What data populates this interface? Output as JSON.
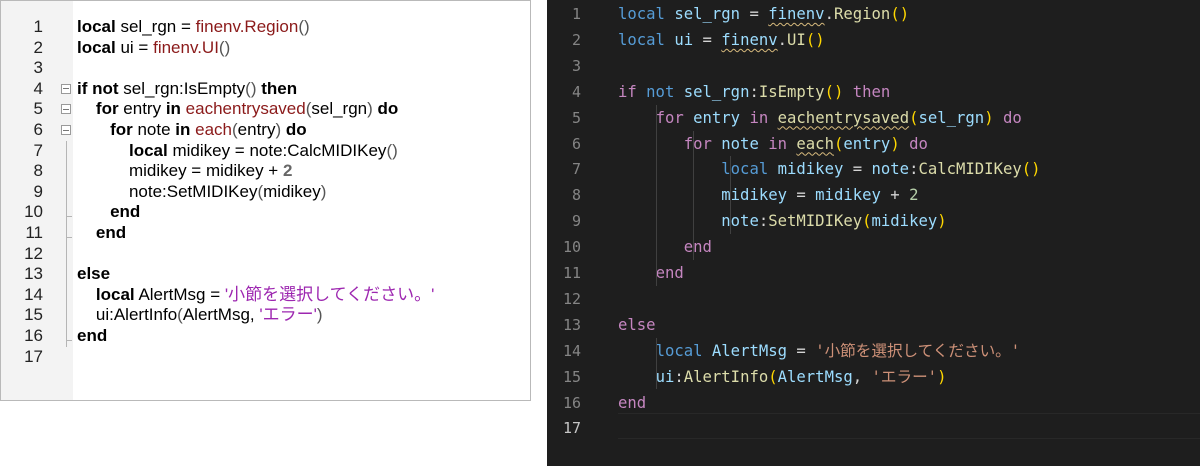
{
  "left_editor": {
    "line_numbers": [
      "1",
      "2",
      "3",
      "4",
      "5",
      "6",
      "7",
      "8",
      "9",
      "10",
      "11",
      "12",
      "13",
      "14",
      "15",
      "16",
      "17"
    ],
    "lines": [
      [
        [
          "kw",
          "local"
        ],
        [
          "t",
          " sel_rgn = "
        ],
        [
          "fn",
          "finenv.Region"
        ],
        [
          "p",
          "()"
        ]
      ],
      [
        [
          "kw",
          "local"
        ],
        [
          "t",
          " ui = "
        ],
        [
          "fn",
          "finenv.UI"
        ],
        [
          "p",
          "()"
        ]
      ],
      [],
      [
        [
          "kw",
          "if not"
        ],
        [
          "t",
          " sel_rgn:IsEmpty"
        ],
        [
          "p",
          "()"
        ],
        [
          "t",
          " "
        ],
        [
          "kw",
          "then"
        ]
      ],
      [
        [
          "t",
          "    "
        ],
        [
          "kw",
          "for"
        ],
        [
          "t",
          " entry "
        ],
        [
          "kw",
          "in"
        ],
        [
          "t",
          " "
        ],
        [
          "fn",
          "eachentrysaved"
        ],
        [
          "p",
          "("
        ],
        [
          "t",
          "sel_rgn"
        ],
        [
          "p",
          ")"
        ],
        [
          "t",
          " "
        ],
        [
          "kw",
          "do"
        ]
      ],
      [
        [
          "t",
          "       "
        ],
        [
          "kw",
          "for"
        ],
        [
          "t",
          " note "
        ],
        [
          "kw",
          "in"
        ],
        [
          "t",
          " "
        ],
        [
          "fn",
          "each"
        ],
        [
          "p",
          "("
        ],
        [
          "t",
          "entry"
        ],
        [
          "p",
          ")"
        ],
        [
          "t",
          " "
        ],
        [
          "kw",
          "do"
        ]
      ],
      [
        [
          "t",
          "           "
        ],
        [
          "kw",
          "local"
        ],
        [
          "t",
          " midikey = note:CalcMIDIKey"
        ],
        [
          "p",
          "()"
        ]
      ],
      [
        [
          "t",
          "           midikey = midikey + "
        ],
        [
          "n",
          "2"
        ]
      ],
      [
        [
          "t",
          "           note:SetMIDIKey"
        ],
        [
          "p",
          "("
        ],
        [
          "t",
          "midikey"
        ],
        [
          "p",
          ")"
        ]
      ],
      [
        [
          "t",
          "       "
        ],
        [
          "kw",
          "end"
        ]
      ],
      [
        [
          "t",
          "    "
        ],
        [
          "kw",
          "end"
        ]
      ],
      [],
      [
        [
          "kw",
          "else"
        ]
      ],
      [
        [
          "t",
          "    "
        ],
        [
          "kw",
          "local"
        ],
        [
          "t",
          " AlertMsg = "
        ],
        [
          "s",
          "'小節を選択してください。'"
        ]
      ],
      [
        [
          "t",
          "    ui:AlertInfo"
        ],
        [
          "p",
          "("
        ],
        [
          "t",
          "AlertMsg, "
        ],
        [
          "s",
          "'エラー'"
        ],
        [
          "p",
          ")"
        ]
      ],
      [
        [
          "kw",
          "end"
        ]
      ],
      []
    ]
  },
  "right_editor": {
    "line_numbers": [
      "1",
      "2",
      "3",
      "4",
      "5",
      "6",
      "7",
      "8",
      "9",
      "10",
      "11",
      "12",
      "13",
      "14",
      "15",
      "16",
      "17"
    ],
    "active_line": "17",
    "lines": [
      [
        [
          "kw",
          "local"
        ],
        [
          "t",
          " "
        ],
        [
          "v",
          "sel_rgn"
        ],
        [
          "t",
          " = "
        ],
        [
          "vw",
          "finenv"
        ],
        [
          "t",
          "."
        ],
        [
          "f",
          "Region"
        ],
        [
          "p1",
          "()"
        ]
      ],
      [
        [
          "kw",
          "local"
        ],
        [
          "t",
          " "
        ],
        [
          "v",
          "ui"
        ],
        [
          "t",
          " = "
        ],
        [
          "vw",
          "finenv"
        ],
        [
          "t",
          "."
        ],
        [
          "f",
          "UI"
        ],
        [
          "p1",
          "()"
        ]
      ],
      [],
      [
        [
          "c",
          "if"
        ],
        [
          "t",
          " "
        ],
        [
          "kw",
          "not"
        ],
        [
          "t",
          " "
        ],
        [
          "v",
          "sel_rgn"
        ],
        [
          "t",
          ":"
        ],
        [
          "f",
          "IsEmpty"
        ],
        [
          "p1",
          "()"
        ],
        [
          "t",
          " "
        ],
        [
          "c",
          "then"
        ]
      ],
      [
        [
          "t",
          "    "
        ],
        [
          "c",
          "for"
        ],
        [
          "t",
          " "
        ],
        [
          "v",
          "entry"
        ],
        [
          "t",
          " "
        ],
        [
          "c",
          "in"
        ],
        [
          "t",
          " "
        ],
        [
          "fw",
          "eachentrysaved"
        ],
        [
          "p1",
          "("
        ],
        [
          "v",
          "sel_rgn"
        ],
        [
          "p1",
          ")"
        ],
        [
          "t",
          " "
        ],
        [
          "c",
          "do"
        ]
      ],
      [
        [
          "t",
          "       "
        ],
        [
          "c",
          "for"
        ],
        [
          "t",
          " "
        ],
        [
          "v",
          "note"
        ],
        [
          "t",
          " "
        ],
        [
          "c",
          "in"
        ],
        [
          "t",
          " "
        ],
        [
          "fw",
          "each"
        ],
        [
          "p1",
          "("
        ],
        [
          "v",
          "entry"
        ],
        [
          "p1",
          ")"
        ],
        [
          "t",
          " "
        ],
        [
          "c",
          "do"
        ]
      ],
      [
        [
          "t",
          "           "
        ],
        [
          "kw",
          "local"
        ],
        [
          "t",
          " "
        ],
        [
          "v",
          "midikey"
        ],
        [
          "t",
          " = "
        ],
        [
          "v",
          "note"
        ],
        [
          "t",
          ":"
        ],
        [
          "f",
          "CalcMIDIKey"
        ],
        [
          "p1",
          "()"
        ]
      ],
      [
        [
          "t",
          "           "
        ],
        [
          "v",
          "midikey"
        ],
        [
          "t",
          " = "
        ],
        [
          "v",
          "midikey"
        ],
        [
          "t",
          " + "
        ],
        [
          "n",
          "2"
        ]
      ],
      [
        [
          "t",
          "           "
        ],
        [
          "v",
          "note"
        ],
        [
          "t",
          ":"
        ],
        [
          "f",
          "SetMIDIKey"
        ],
        [
          "p1",
          "("
        ],
        [
          "v",
          "midikey"
        ],
        [
          "p1",
          ")"
        ]
      ],
      [
        [
          "t",
          "       "
        ],
        [
          "c",
          "end"
        ]
      ],
      [
        [
          "t",
          "    "
        ],
        [
          "c",
          "end"
        ]
      ],
      [],
      [
        [
          "c",
          "else"
        ]
      ],
      [
        [
          "t",
          "    "
        ],
        [
          "kw",
          "local"
        ],
        [
          "t",
          " "
        ],
        [
          "v",
          "AlertMsg"
        ],
        [
          "t",
          " = "
        ],
        [
          "s",
          "'小節を選択してください。'"
        ]
      ],
      [
        [
          "t",
          "    "
        ],
        [
          "v",
          "ui"
        ],
        [
          "t",
          ":"
        ],
        [
          "f",
          "AlertInfo"
        ],
        [
          "p1",
          "("
        ],
        [
          "v",
          "AlertMsg"
        ],
        [
          "t",
          ", "
        ],
        [
          "s",
          "'エラー'"
        ],
        [
          "p1",
          ")"
        ]
      ],
      [
        [
          "c",
          "end"
        ]
      ],
      []
    ]
  }
}
